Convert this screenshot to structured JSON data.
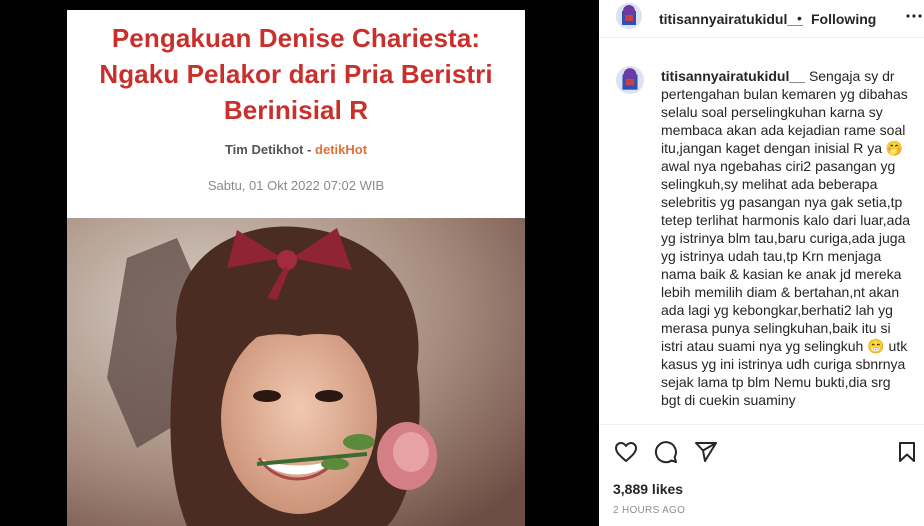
{
  "post": {
    "username": "titisannyairatukidul__",
    "separator": "•",
    "follow_status": "Following",
    "caption_user": "titisannyairatukidul__",
    "caption_text": "Sengaja sy dr pertengahan bulan kemaren yg dibahas selalu soal perselingkuhan karna sy membaca akan ada kejadian rame soal itu,jangan kaget dengan inisial R ya 🤭 awal nya ngebahas ciri2 pasangan yg selingkuh,sy melihat ada beberapa selebritis yg pasangan nya gak setia,tp tetep terlihat harmonis kalo dari luar,ada yg istrinya blm tau,baru curiga,ada juga yg istrinya udah tau,tp Krn menjaga nama baik & kasian ke anak jd mereka lebih memilih diam & bertahan,nt akan ada lagi yg kebongkar,berhati2 lah yg merasa punya selingkuhan,baik itu si istri atau suami nya yg selingkuh 😁 utk kasus yg ini istrinya udh curiga sbnrnya sejak lama tp blm Nemu bukti,dia srg bgt di cuekin suaminy",
    "likes": "3,889 likes",
    "time": "2 HOURS AGO"
  },
  "article": {
    "title_lines": [
      "Pengakuan Denise Chariesta:",
      "Ngaku Pelakor dari Pria Beristri",
      "Berinisial R"
    ],
    "author": "Tim Detikhot",
    "byline_sep": " - ",
    "source": "detikHot",
    "date": "Sabtu, 01 Okt 2022 07:02 WIB"
  },
  "icons": {
    "more": "more-options-icon",
    "like": "heart-icon",
    "comment": "comment-icon",
    "share": "share-icon",
    "save": "bookmark-icon"
  },
  "colors": {
    "headline": "#c9302c",
    "source_link": "#e0703a",
    "text": "#262626",
    "muted": "#8e8e8e"
  }
}
